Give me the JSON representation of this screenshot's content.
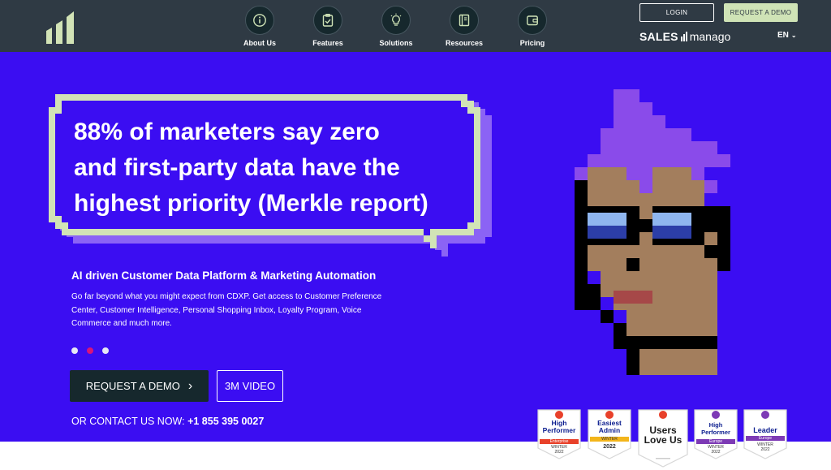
{
  "nav": {
    "items": [
      {
        "label": "About Us",
        "icon": "info-icon"
      },
      {
        "label": "Features",
        "icon": "clipboard-check-icon"
      },
      {
        "label": "Solutions",
        "icon": "lightbulb-icon"
      },
      {
        "label": "Resources",
        "icon": "book-icon"
      },
      {
        "label": "Pricing",
        "icon": "wallet-icon"
      }
    ],
    "login": "LOGIN",
    "request_demo": "REQUEST A DEMO",
    "brand_sales": "SALES",
    "brand_manago": "manago",
    "language": "EN"
  },
  "hero": {
    "headline_lines": [
      "88% of marketers say zero",
      "and first-party data have the",
      "highest priority (Merkle report)"
    ],
    "subtitle": "AI driven Customer Data Platform & Marketing Automation",
    "description": "Go far beyond what you might expect from CDXP. Get access to Customer Preference Center, Customer Intelligence, Personal Shopping Inbox, Loyalty Program, Voice Commerce and much more.",
    "request_demo_label": "REQUEST A DEMO",
    "video_label": "3M VIDEO",
    "contact_prefix": "OR CONTACT US NOW:",
    "contact_phone": "+1 855 395 0027",
    "carousel_active_index": 1
  },
  "badges": [
    {
      "title1": "High",
      "title2": "Performer",
      "band": "Enterprise",
      "season": "WINTER",
      "year": "2022",
      "band_color": "#e8412a"
    },
    {
      "title1": "Easiest",
      "title2": "Admin",
      "band": "WINTER",
      "season": "",
      "year": "2022",
      "band_color": "#f3b51b"
    },
    {
      "title1": "Users",
      "title2": "Love Us",
      "band": "",
      "season": "",
      "year": "",
      "band_color": "#ffffff"
    },
    {
      "title1": "High",
      "title2": "Performer",
      "band": "Europe",
      "season": "WINTER",
      "year": "2022",
      "band_color": "#7d3ab5"
    },
    {
      "title1": "Leader",
      "title2": "",
      "band": "Europe",
      "season": "WINTER",
      "year": "2022",
      "band_color": "#7d3ab5"
    }
  ],
  "colors": {
    "topbar": "#2f3a44",
    "hero_bg": "#3b0df2",
    "accent_green": "#cfe3b6",
    "dark_button": "#16282d",
    "dot_active": "#d9157a",
    "face_skin": "#a37e5d",
    "hair": "#8a4bea"
  }
}
